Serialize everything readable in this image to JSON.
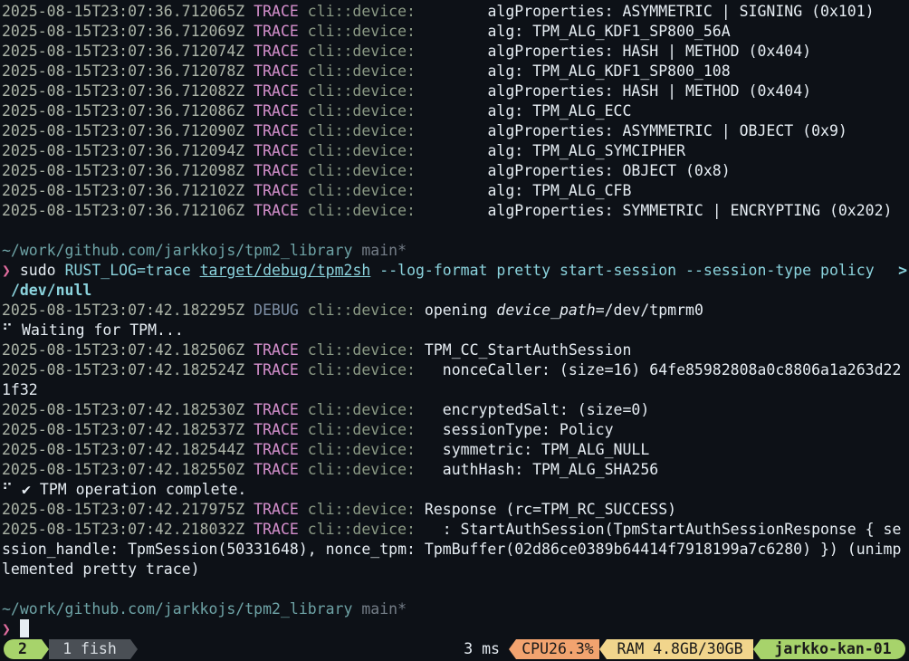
{
  "terminal": {
    "block1": [
      {
        "ts": "2025-08-15T23:07:36.712065Z",
        "level": "TRACE",
        "target": "cli::device:",
        "msg": "        algProperties: ASYMMETRIC | SIGNING (0x101)"
      },
      {
        "ts": "2025-08-15T23:07:36.712069Z",
        "level": "TRACE",
        "target": "cli::device:",
        "msg": "        alg: TPM_ALG_KDF1_SP800_56A"
      },
      {
        "ts": "2025-08-15T23:07:36.712074Z",
        "level": "TRACE",
        "target": "cli::device:",
        "msg": "        algProperties: HASH | METHOD (0x404)"
      },
      {
        "ts": "2025-08-15T23:07:36.712078Z",
        "level": "TRACE",
        "target": "cli::device:",
        "msg": "        alg: TPM_ALG_KDF1_SP800_108"
      },
      {
        "ts": "2025-08-15T23:07:36.712082Z",
        "level": "TRACE",
        "target": "cli::device:",
        "msg": "        algProperties: HASH | METHOD (0x404)"
      },
      {
        "ts": "2025-08-15T23:07:36.712086Z",
        "level": "TRACE",
        "target": "cli::device:",
        "msg": "        alg: TPM_ALG_ECC"
      },
      {
        "ts": "2025-08-15T23:07:36.712090Z",
        "level": "TRACE",
        "target": "cli::device:",
        "msg": "        algProperties: ASYMMETRIC | OBJECT (0x9)"
      },
      {
        "ts": "2025-08-15T23:07:36.712094Z",
        "level": "TRACE",
        "target": "cli::device:",
        "msg": "        alg: TPM_ALG_SYMCIPHER"
      },
      {
        "ts": "2025-08-15T23:07:36.712098Z",
        "level": "TRACE",
        "target": "cli::device:",
        "msg": "        algProperties: OBJECT (0x8)"
      },
      {
        "ts": "2025-08-15T23:07:36.712102Z",
        "level": "TRACE",
        "target": "cli::device:",
        "msg": "        alg: TPM_ALG_CFB"
      },
      {
        "ts": "2025-08-15T23:07:36.712106Z",
        "level": "TRACE",
        "target": "cli::device:",
        "msg": "        algProperties: SYMMETRIC | ENCRYPTING (0x202)"
      }
    ],
    "prompt1": {
      "cwd": "~/work/github.com/jarkkojs/tpm2_library",
      "branch": "main*"
    },
    "command": {
      "arrow": "❯",
      "sudo": "sudo",
      "env": "RUST_LOG=trace",
      "binary": "target/debug/tpm2sh",
      "args": "--log-format pretty start-session --session-type policy",
      "overflow": ">",
      "redirect": "/dev/null"
    },
    "debug_line": {
      "ts": "2025-08-15T23:07:42.182295Z",
      "level": "DEBUG",
      "target": "cli::device:",
      "msg_pre": "opening ",
      "field": "device_path",
      "msg_post": "=/dev/tpmrm0"
    },
    "waiting": "⠋ Waiting for TPM...",
    "block2": [
      {
        "ts": "2025-08-15T23:07:42.182506Z",
        "level": "TRACE",
        "target": "cli::device:",
        "msg": "TPM_CC_StartAuthSession"
      },
      {
        "ts": "2025-08-15T23:07:42.182524Z",
        "level": "TRACE",
        "target": "cli::device:",
        "msg": "  nonceCaller: (size=16) 64fe85982808a0c8806a1a263d22"
      }
    ],
    "wrap1": "1f32",
    "block3": [
      {
        "ts": "2025-08-15T23:07:42.182530Z",
        "level": "TRACE",
        "target": "cli::device:",
        "msg": "  encryptedSalt: (size=0)"
      },
      {
        "ts": "2025-08-15T23:07:42.182537Z",
        "level": "TRACE",
        "target": "cli::device:",
        "msg": "  sessionType: Policy"
      },
      {
        "ts": "2025-08-15T23:07:42.182544Z",
        "level": "TRACE",
        "target": "cli::device:",
        "msg": "  symmetric: TPM_ALG_NULL"
      },
      {
        "ts": "2025-08-15T23:07:42.182550Z",
        "level": "TRACE",
        "target": "cli::device:",
        "msg": "  authHash: TPM_ALG_SHA256"
      }
    ],
    "complete": "⠋ ✔ TPM operation complete.",
    "block4": [
      {
        "ts": "2025-08-15T23:07:42.217975Z",
        "level": "TRACE",
        "target": "cli::device:",
        "msg": "Response (rc=TPM_RC_SUCCESS)"
      },
      {
        "ts": "2025-08-15T23:07:42.218032Z",
        "level": "TRACE",
        "target": "cli::device:",
        "msg": "  : StartAuthSession(TpmStartAuthSessionResponse { se"
      }
    ],
    "wrap2": "ssion_handle: TpmSession(50331648), nonce_tpm: TpmBuffer(02d86ce0389b64414f7918199a7c6280) }) (unimp",
    "wrap3": "lemented pretty trace)",
    "prompt2": {
      "cwd": "~/work/github.com/jarkkojs/tpm2_library",
      "branch": "main*",
      "arrow": "❯"
    }
  },
  "status_bar": {
    "window_number": "2",
    "tab": "1 fish",
    "duration": "3 ms",
    "cpu": "CPU26.3%",
    "ram": "RAM 4.8GB/30GB",
    "host": "jarkko-kan-01"
  },
  "colors": {
    "background": "#0d1117",
    "trace": "#d58fcd",
    "debug": "#7d8fa5",
    "accent_green": "#a7d36b",
    "cpu_orange": "#f2a36f",
    "ram_yellow": "#f1d58c"
  }
}
